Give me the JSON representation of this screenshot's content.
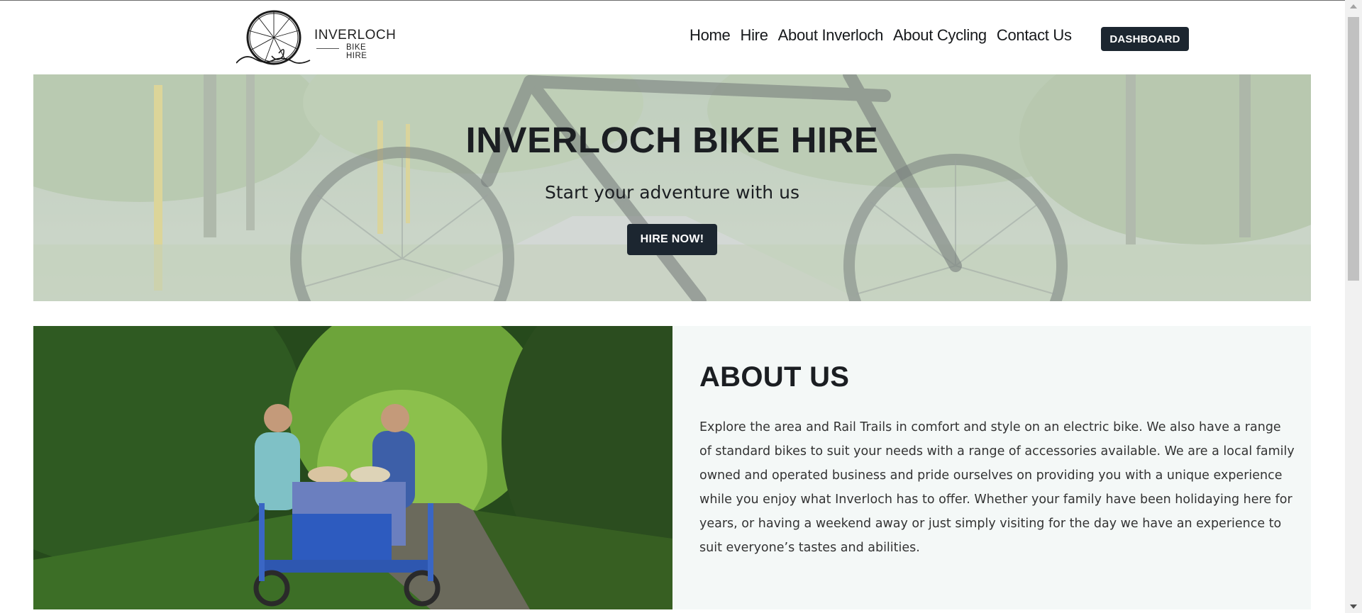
{
  "logo": {
    "line1": "INVERLOCH",
    "line2": "BIKE HIRE",
    "icon": "bicycle-wheel-logo-icon"
  },
  "nav": {
    "items": [
      "Home",
      "Hire",
      "About Inverloch",
      "About Cycling",
      "Contact Us"
    ],
    "dashboard_label": "DASHBOARD"
  },
  "hero": {
    "title": "INVERLOCH BIKE HIRE",
    "subtitle": "Start your adventure with us",
    "cta_label": "HIRE NOW!"
  },
  "about": {
    "title": "ABOUT US",
    "text": "Explore the area and Rail Trails in comfort and style on an electric bike. We also have a range of standard bikes to suit your needs with a range of accessories available. We are a local family owned and operated business and pride ourselves on providing you with a unique experience while you enjoy what Inverloch has to offer. Whether your family have been holidaying here for years, or having a weekend away or just simply visiting for the day we have an experience to suit everyone’s tastes and abilities."
  },
  "colors": {
    "button_bg": "#1c2630",
    "about_panel_bg": "#f4f8f7",
    "text_dark": "#1b1e22"
  }
}
